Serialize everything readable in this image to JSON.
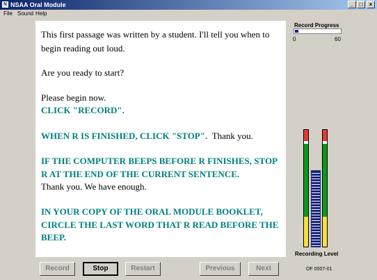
{
  "window": {
    "title": "NSAA Oral Module",
    "icon": "app-icon",
    "controls": [
      "minimize-icon",
      "maximize-icon",
      "close-icon"
    ]
  },
  "menu": {
    "items": [
      "File",
      "Sound",
      "Help"
    ]
  },
  "passage": {
    "l1": "This first passage was written by a student. I'll tell you when to",
    "l2": "begin reading out loud.",
    "l3": "Are you ready to start?",
    "l4": "Please begin now.",
    "l5": "CLICK \"RECORD\".",
    "l6a": "WHEN R IS FINISHED, CLICK \"STOP\".",
    "l6b": "Thank you.",
    "l7": "IF THE COMPUTER BEEPS BEFORE R FINISHES, STOP",
    "l8": "R AT THE END OF THE CURRENT SENTENCE.",
    "l9": "Thank you. We have enough.",
    "l10": "IN YOUR COPY OF THE ORAL MODULE BOOKLET,",
    "l11": "CIRCLE THE LAST WORD THAT R READ BEFORE THE",
    "l12": "BEEP."
  },
  "record_progress": {
    "label": "Record Progress",
    "min": "0",
    "max": "60",
    "value_fraction": 0.16
  },
  "recording_level": {
    "label": "Recording Level",
    "value_fraction": 0.65
  },
  "buttons": {
    "record": "Record",
    "stop": "Stop",
    "restart": "Restart",
    "previous": "Previous",
    "next": "Next"
  },
  "version": "OF 0007-01",
  "colors": {
    "accent_text": "#008080",
    "meter_red": "#e53935",
    "meter_green": "#0a9a1a",
    "meter_yellow": "#f6e040",
    "level_bar": "#1a237e"
  }
}
